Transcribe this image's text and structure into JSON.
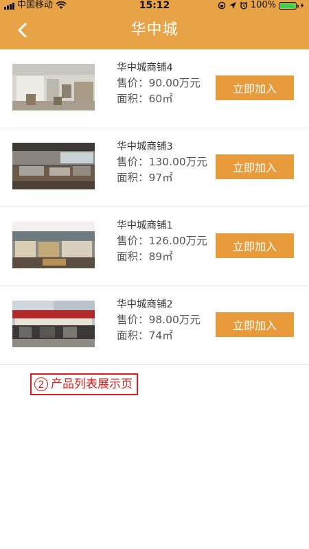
{
  "status_bar": {
    "carrier": "中国移动",
    "time": "15:12",
    "battery": "100%"
  },
  "header": {
    "title": "华中城"
  },
  "items": [
    {
      "name": "华中城商铺4",
      "price": "售价：90.00万元",
      "area": "面积：60㎡",
      "button": "立即加入",
      "photo": "warehouse-interior"
    },
    {
      "name": "华中城商铺3",
      "price": "售价：130.00万元",
      "area": "面积：97㎡",
      "button": "立即加入",
      "photo": "furniture-showroom"
    },
    {
      "name": "华中城商铺1",
      "price": "售价：126.00万元",
      "area": "面积：89㎡",
      "button": "立即加入",
      "photo": "furniture-store"
    },
    {
      "name": "华中城商铺2",
      "price": "售价：98.00万元",
      "area": "面积：74㎡",
      "button": "立即加入",
      "photo": "storefront-street"
    }
  ],
  "annotation": {
    "number": "2",
    "text": "产品列表展示页"
  },
  "colors": {
    "header_bg": "#e9a347",
    "button_bg": "#e89b3b",
    "annotation": "#e11b1b",
    "battery": "#3ed04f"
  }
}
